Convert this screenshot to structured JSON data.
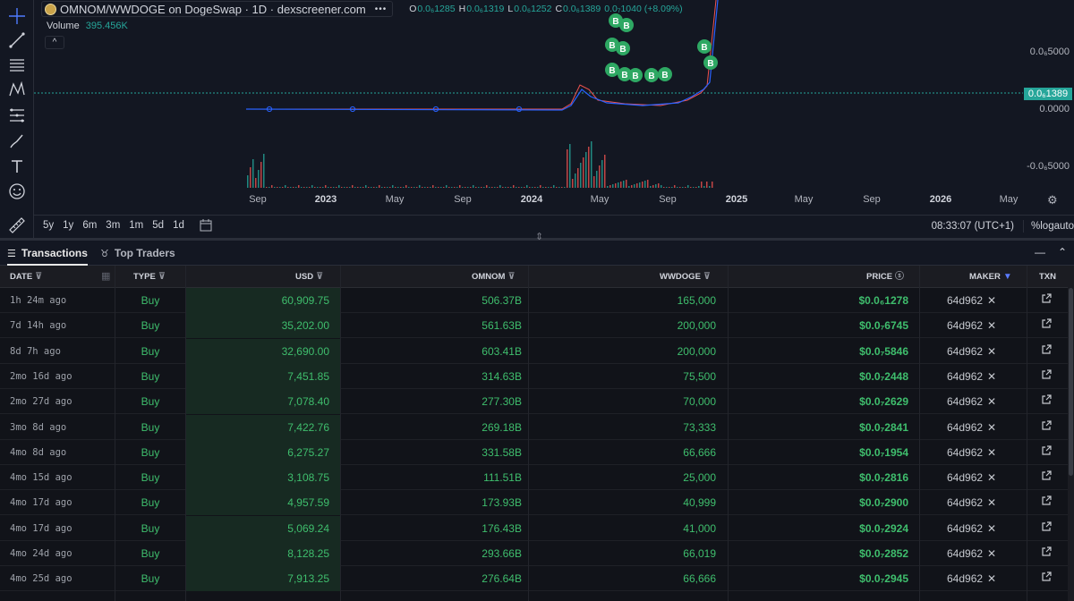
{
  "chart": {
    "pair_title": "OMNOM/WWDOGE on DogeSwap · 1D · dexscreener.com",
    "more_menu": "•••",
    "ohlc": {
      "o_label": "O",
      "o": "0.0₆1285",
      "h_label": "H",
      "h": "0.0₆1319",
      "l_label": "L",
      "l": "0.0₆1252",
      "c_label": "C",
      "c": "0.0₆1389",
      "change": "0.0₇1040 (+8.09%)"
    },
    "volume_label": "Volume",
    "volume_value": "395.456K",
    "collapse_symbol": "^",
    "price_labels": [
      "0.0₆5000",
      "0.0000",
      "-0.0₆5000"
    ],
    "last_price": "0.0₆1389",
    "time_labels": [
      {
        "text": "Sep",
        "year": false
      },
      {
        "text": "2023",
        "year": true
      },
      {
        "text": "May",
        "year": false
      },
      {
        "text": "Sep",
        "year": false
      },
      {
        "text": "2024",
        "year": true
      },
      {
        "text": "May",
        "year": false
      },
      {
        "text": "Sep",
        "year": false
      },
      {
        "text": "2025",
        "year": true
      },
      {
        "text": "May",
        "year": false
      },
      {
        "text": "Sep",
        "year": false
      },
      {
        "text": "2026",
        "year": true
      },
      {
        "text": "May",
        "year": false
      }
    ],
    "ranges": [
      "5y",
      "1y",
      "6m",
      "3m",
      "1m",
      "5d",
      "1d"
    ],
    "clock": "08:33:07 (UTC+1)",
    "opt_percent": "%",
    "opt_log": "log",
    "opt_auto": "auto",
    "trade_markers": [
      "B",
      "B",
      "B",
      "B",
      "B",
      "B",
      "B",
      "B",
      "B",
      "B",
      "B"
    ]
  },
  "tabs": {
    "transactions": "Transactions",
    "top_traders": "Top Traders",
    "minimize": "—",
    "expand": "⌃"
  },
  "table": {
    "headers": {
      "date": "DATE",
      "type": "TYPE",
      "usd": "USD",
      "omnom": "OMNOM",
      "wwdoge": "WWDOGE",
      "price": "PRICE",
      "maker": "MAKER",
      "txn": "TXN"
    },
    "rows": [
      {
        "date": "1h 24m ago",
        "type": "Buy",
        "usd": "60,909.75",
        "omnom": "506.37B",
        "wwdoge": "165,000",
        "price": "$0.0₆1278",
        "maker": "64d962"
      },
      {
        "date": "7d 14h ago",
        "type": "Buy",
        "usd": "35,202.00",
        "omnom": "561.63B",
        "wwdoge": "200,000",
        "price": "$0.0₇6745",
        "maker": "64d962"
      },
      {
        "date": "8d 7h ago",
        "type": "Buy",
        "usd": "32,690.00",
        "omnom": "603.41B",
        "wwdoge": "200,000",
        "price": "$0.0₇5846",
        "maker": "64d962"
      },
      {
        "date": "2mo 16d ago",
        "type": "Buy",
        "usd": "7,451.85",
        "omnom": "314.63B",
        "wwdoge": "75,500",
        "price": "$0.0₇2448",
        "maker": "64d962"
      },
      {
        "date": "2mo 27d ago",
        "type": "Buy",
        "usd": "7,078.40",
        "omnom": "277.30B",
        "wwdoge": "70,000",
        "price": "$0.0₇2629",
        "maker": "64d962"
      },
      {
        "date": "3mo 8d ago",
        "type": "Buy",
        "usd": "7,422.76",
        "omnom": "269.18B",
        "wwdoge": "73,333",
        "price": "$0.0₇2841",
        "maker": "64d962"
      },
      {
        "date": "4mo 8d ago",
        "type": "Buy",
        "usd": "6,275.27",
        "omnom": "331.58B",
        "wwdoge": "66,666",
        "price": "$0.0₇1954",
        "maker": "64d962"
      },
      {
        "date": "4mo 15d ago",
        "type": "Buy",
        "usd": "3,108.75",
        "omnom": "111.51B",
        "wwdoge": "25,000",
        "price": "$0.0₇2816",
        "maker": "64d962"
      },
      {
        "date": "4mo 17d ago",
        "type": "Buy",
        "usd": "4,957.59",
        "omnom": "173.93B",
        "wwdoge": "40,999",
        "price": "$0.0₇2900",
        "maker": "64d962"
      },
      {
        "date": "4mo 17d ago",
        "type": "Buy",
        "usd": "5,069.24",
        "omnom": "176.43B",
        "wwdoge": "41,000",
        "price": "$0.0₇2924",
        "maker": "64d962"
      },
      {
        "date": "4mo 24d ago",
        "type": "Buy",
        "usd": "8,128.25",
        "omnom": "293.66B",
        "wwdoge": "66,019",
        "price": "$0.0₇2852",
        "maker": "64d962"
      },
      {
        "date": "4mo 25d ago",
        "type": "Buy",
        "usd": "7,913.25",
        "omnom": "276.64B",
        "wwdoge": "66,666",
        "price": "$0.0₇2945",
        "maker": "64d962"
      }
    ]
  },
  "colors": {
    "up": "#26a69a",
    "buy": "#3fbe6d",
    "marker": "#2ea863",
    "line_blue": "#2962ff",
    "line_red": "#ef5350",
    "maker_filter": "#5b7cff"
  }
}
